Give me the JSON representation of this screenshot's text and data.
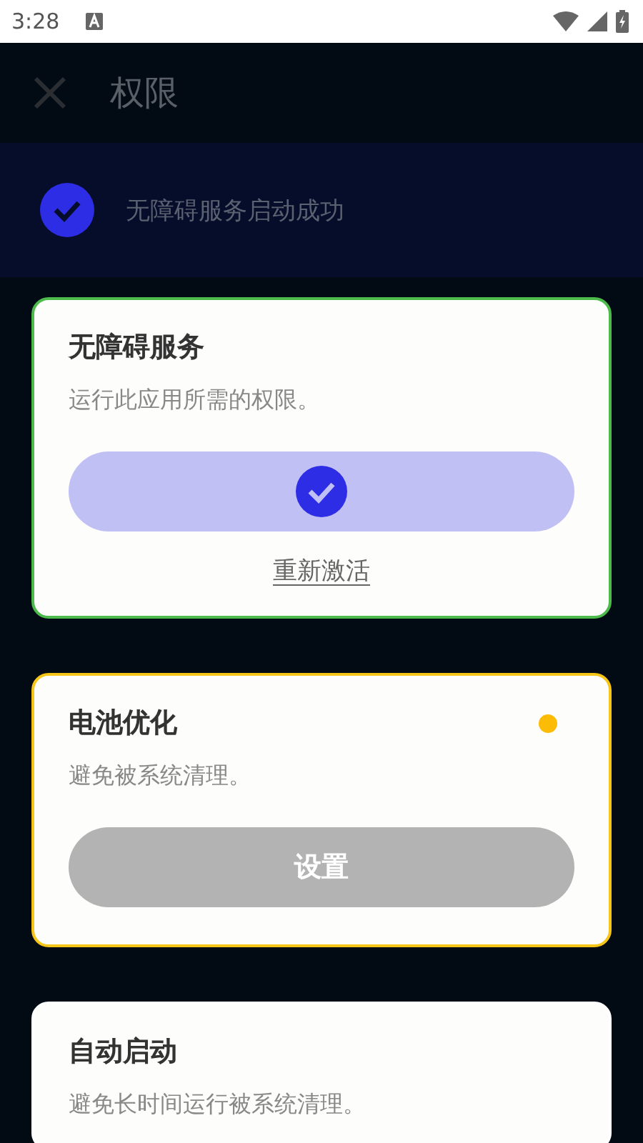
{
  "status_bar": {
    "time": "3:28"
  },
  "app_bar": {
    "title": "权限"
  },
  "banner": {
    "text": "无障碍服务启动成功",
    "done": true
  },
  "cards": [
    {
      "kind": "activated",
      "title": "无障碍服务",
      "description": "运行此应用所需的权限。",
      "color": "#4cbb4c",
      "warning": false,
      "link": "重新激活"
    },
    {
      "kind": "setup",
      "title": "电池优化",
      "description": "避免被系统清理。",
      "color": "#f5c518",
      "warning": true,
      "button": "设置"
    },
    {
      "kind": "setup",
      "title": "自动启动",
      "description": "避免长时间运行被系统清理。",
      "warning": false
    }
  ]
}
